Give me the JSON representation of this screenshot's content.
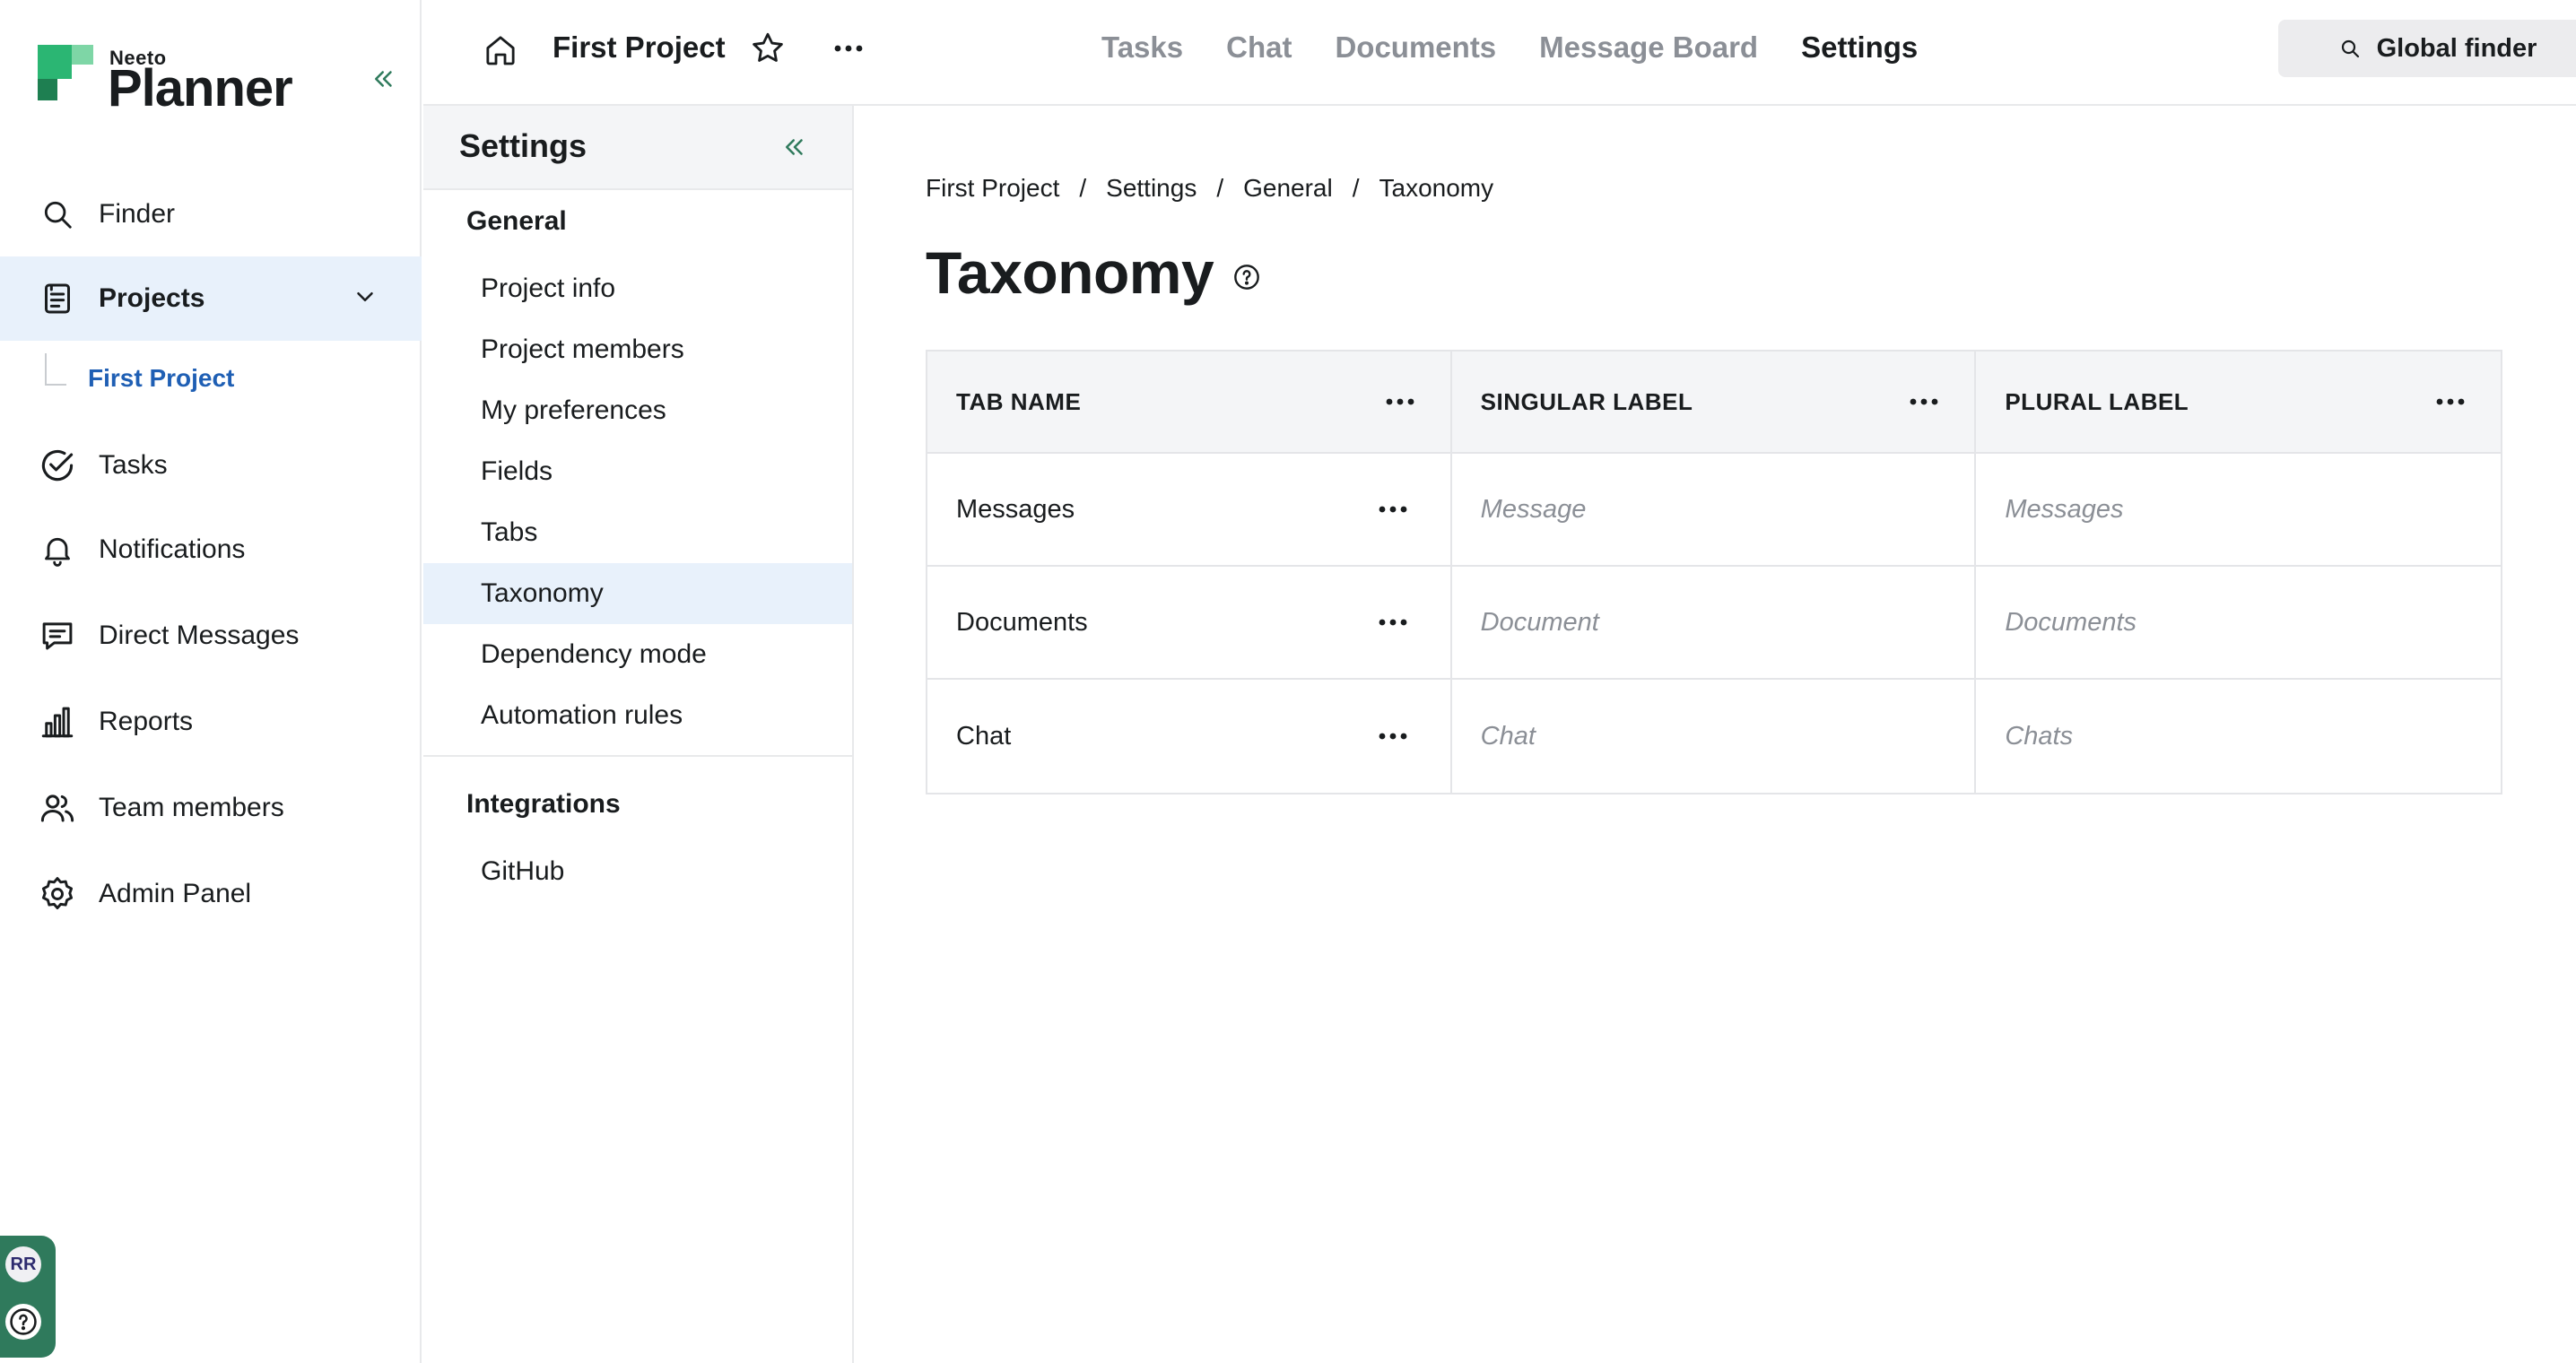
{
  "brand": {
    "small": "Neeto",
    "name": "Planner",
    "accent": "#2bb673",
    "accent_dark": "#1e7f51"
  },
  "sidebar": {
    "items": [
      {
        "label": "Finder",
        "icon": "search-icon"
      },
      {
        "label": "Projects",
        "icon": "document-icon",
        "active": true,
        "expanded": true
      },
      {
        "label": "Tasks",
        "icon": "check-circle-icon"
      },
      {
        "label": "Notifications",
        "icon": "bell-icon"
      },
      {
        "label": "Direct Messages",
        "icon": "message-icon"
      },
      {
        "label": "Reports",
        "icon": "bar-chart-icon"
      },
      {
        "label": "Team members",
        "icon": "users-icon"
      },
      {
        "label": "Admin Panel",
        "icon": "gear-icon"
      }
    ],
    "sub_item": "First Project",
    "user_initials": "RR"
  },
  "topbar": {
    "project_title": "First Project",
    "tabs": [
      {
        "label": "Tasks"
      },
      {
        "label": "Chat"
      },
      {
        "label": "Documents"
      },
      {
        "label": "Message Board"
      },
      {
        "label": "Settings",
        "active": true
      }
    ],
    "global_finder": "Global finder"
  },
  "settings": {
    "title": "Settings",
    "groups": [
      {
        "title": "General",
        "items": [
          "Project info",
          "Project members",
          "My preferences",
          "Fields",
          "Tabs",
          "Taxonomy",
          "Dependency mode",
          "Automation rules"
        ],
        "active": "Taxonomy"
      },
      {
        "title": "Integrations",
        "items": [
          "GitHub"
        ]
      }
    ]
  },
  "breadcrumb": [
    "First Project",
    "Settings",
    "General",
    "Taxonomy"
  ],
  "page_title": "Taxonomy",
  "table": {
    "columns": [
      "TAB NAME",
      "SINGULAR LABEL",
      "PLURAL LABEL"
    ],
    "rows": [
      {
        "tab_name": "Messages",
        "singular": "Message",
        "plural": "Messages"
      },
      {
        "tab_name": "Documents",
        "singular": "Document",
        "plural": "Documents"
      },
      {
        "tab_name": "Chat",
        "singular": "Chat",
        "plural": "Chats"
      }
    ]
  },
  "colors": {
    "active_bg": "#e8f1fb",
    "link": "#1f5fb4",
    "muted_text": "#8b8f96",
    "widget_green": "#2f7a5c"
  }
}
